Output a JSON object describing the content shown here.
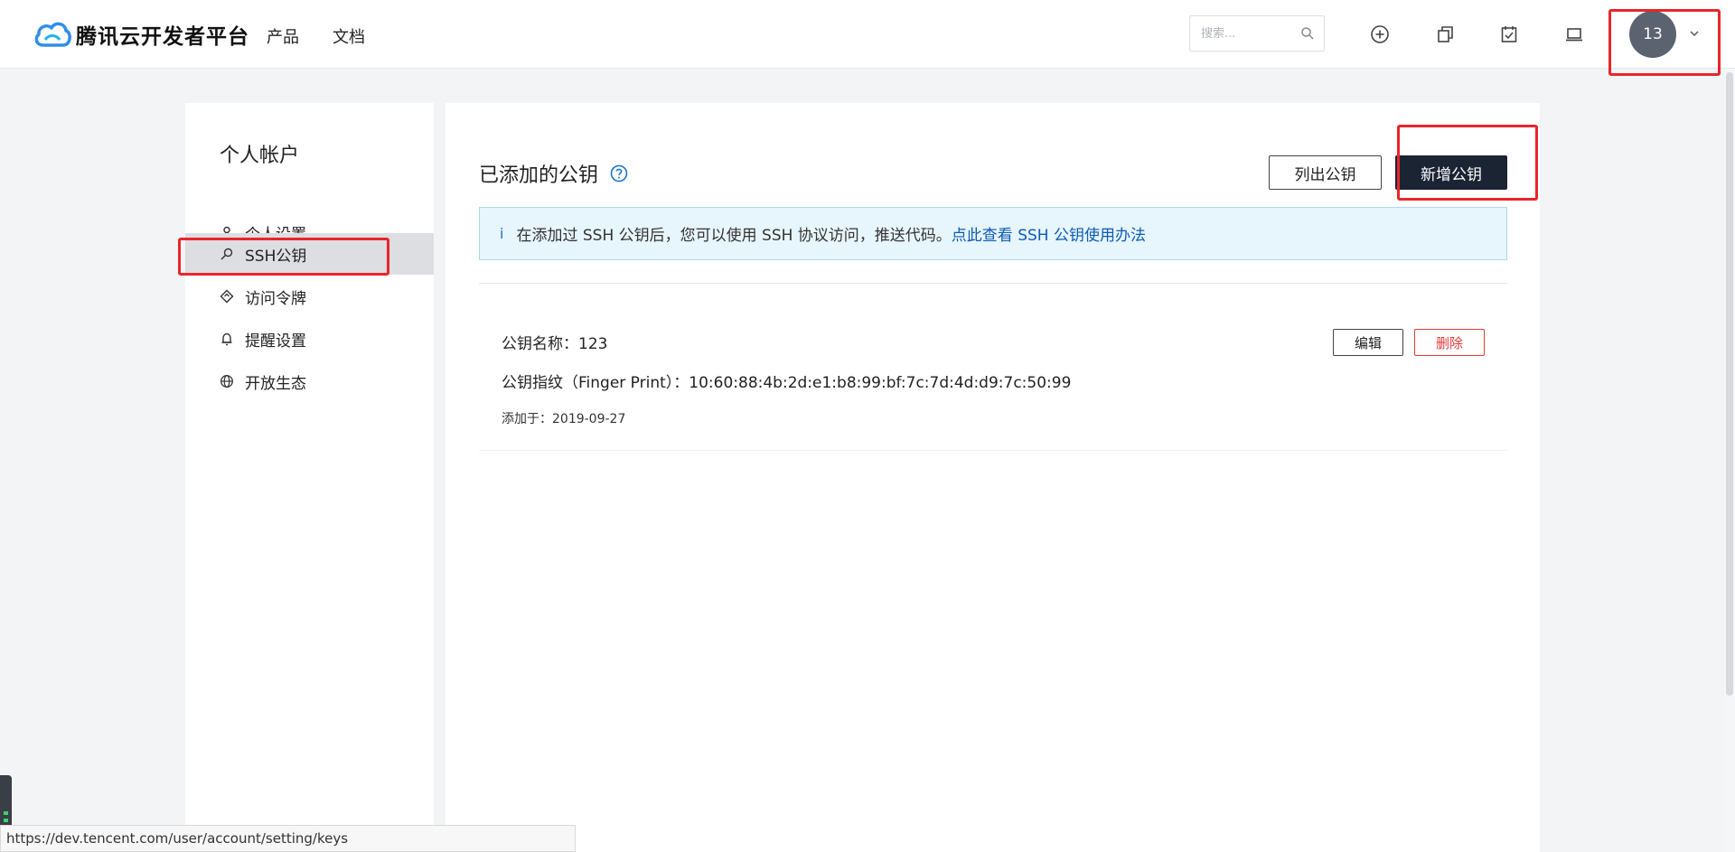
{
  "header": {
    "logo_text": "腾讯云开发者平台",
    "nav": [
      {
        "label": "产品"
      },
      {
        "label": "文档"
      }
    ],
    "search_placeholder": "搜索...",
    "avatar_text": "13"
  },
  "sidebar": {
    "title": "个人帐户",
    "items": [
      {
        "label": "个人设置",
        "icon": "user-icon"
      },
      {
        "label": "SSH公钥",
        "icon": "search-key-icon",
        "active": true
      },
      {
        "label": "访问令牌",
        "icon": "token-icon"
      },
      {
        "label": "提醒设置",
        "icon": "bell-icon"
      },
      {
        "label": "开放生态",
        "icon": "globe-icon"
      }
    ]
  },
  "main": {
    "title": "已添加的公钥",
    "list_button": "列出公钥",
    "add_button": "新增公钥",
    "info": {
      "icon": "i",
      "text": "在添加过 SSH 公钥后，您可以使用 SSH 协议访问，推送代码。",
      "link": "点此查看 SSH 公钥使用办法"
    },
    "keys": [
      {
        "name": "公钥名称：123",
        "fingerprint": "公钥指纹（Finger Print）：10:60:88:4b:2d:e1:b8:99:bf:7c:7d:4d:d9:7c:50:99",
        "added": "添加于：2019-09-27",
        "edit_label": "编辑",
        "delete_label": "删除"
      }
    ]
  },
  "status_url": "https://dev.tencent.com/user/account/setting/keys",
  "colors": {
    "primary_dark": "#1b2433",
    "danger": "#e03a3a",
    "link": "#0b5bb5",
    "info_bg": "#e7f5fc",
    "annotation": "#e8262b"
  }
}
